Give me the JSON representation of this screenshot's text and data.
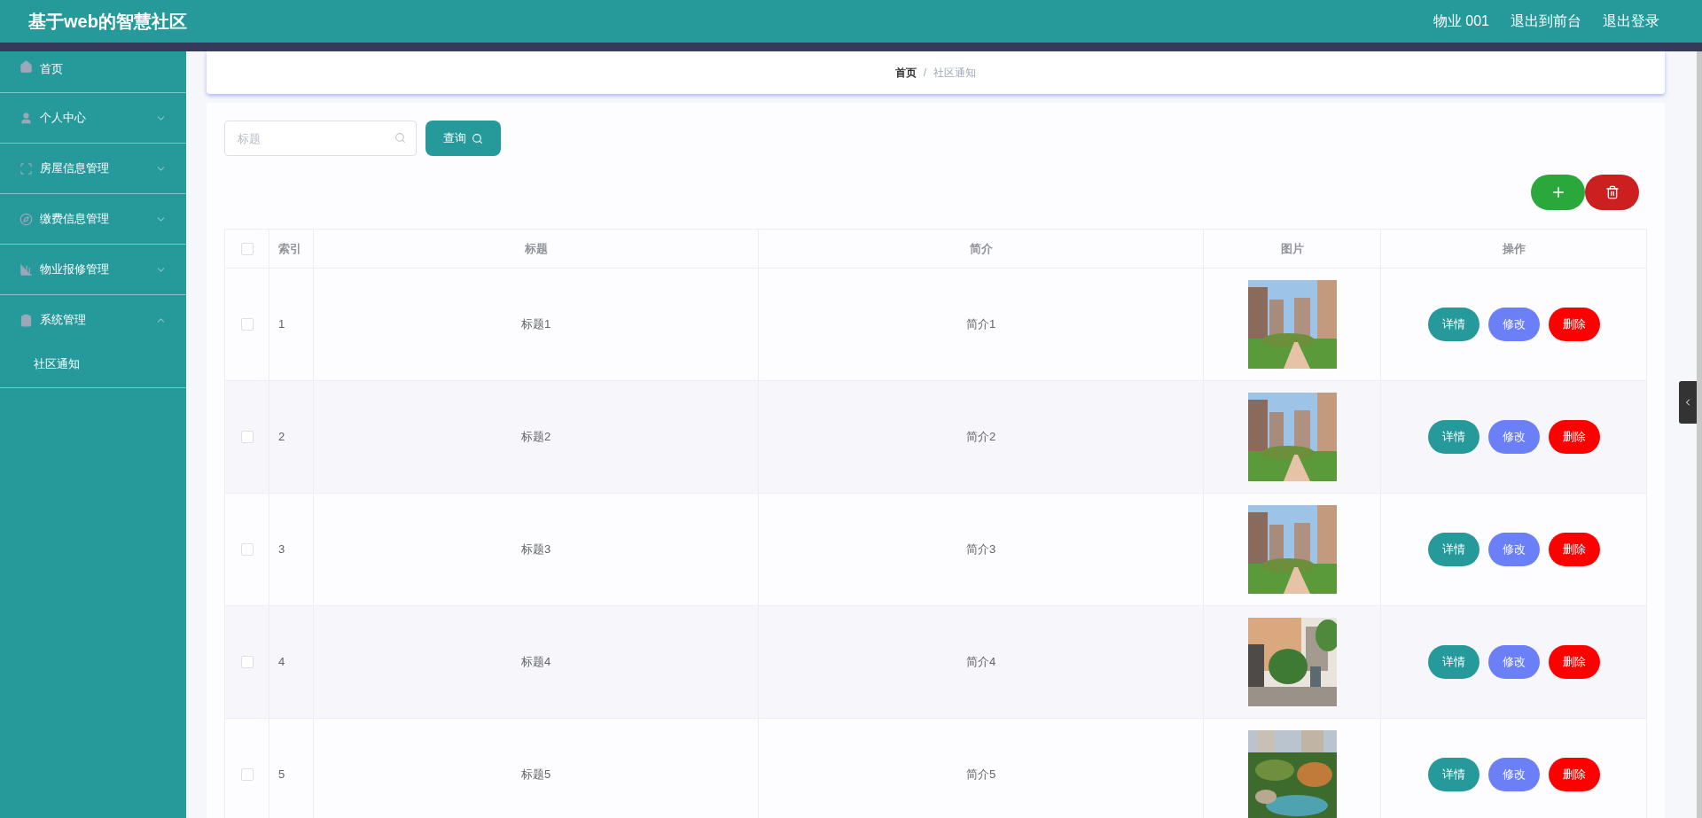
{
  "header": {
    "title": "基于web的智慧社区",
    "links": [
      "物业 001",
      "退出到前台",
      "退出登录"
    ]
  },
  "sidebar": {
    "items": [
      {
        "label": "首页"
      },
      {
        "label": "个人中心",
        "expanded": false
      },
      {
        "label": "房屋信息管理",
        "expanded": false
      },
      {
        "label": "缴费信息管理",
        "expanded": false
      },
      {
        "label": "物业报修管理",
        "expanded": false
      },
      {
        "label": "系统管理",
        "expanded": true,
        "children": [
          {
            "label": "社区通知"
          }
        ]
      }
    ]
  },
  "breadcrumb": [
    "首页",
    "/",
    "社区通知"
  ],
  "search": {
    "placeholder": "标题",
    "button": "查询"
  },
  "table": {
    "header_checked": false,
    "columns": [
      "索引",
      "标题",
      "简介",
      "图片",
      "操作"
    ],
    "rows": [
      {
        "checked": false,
        "index": "1",
        "title": "标题1",
        "intro": "简介1",
        "actions": [
          "详情",
          "修改",
          "删除"
        ]
      },
      {
        "checked": false,
        "index": "2",
        "title": "标题2",
        "intro": "简介2",
        "actions": [
          "详情",
          "修改",
          "删除"
        ]
      },
      {
        "checked": false,
        "index": "3",
        "title": "标题3",
        "intro": "简介3",
        "actions": [
          "详情",
          "修改",
          "删除"
        ]
      },
      {
        "checked": false,
        "index": "4",
        "title": "标题4",
        "intro": "简介4",
        "actions": [
          "详情",
          "修改",
          "删除"
        ]
      },
      {
        "checked": false,
        "index": "5",
        "title": "标题5",
        "intro": "简介5",
        "actions": [
          "详情",
          "修改",
          "删除"
        ]
      }
    ]
  }
}
